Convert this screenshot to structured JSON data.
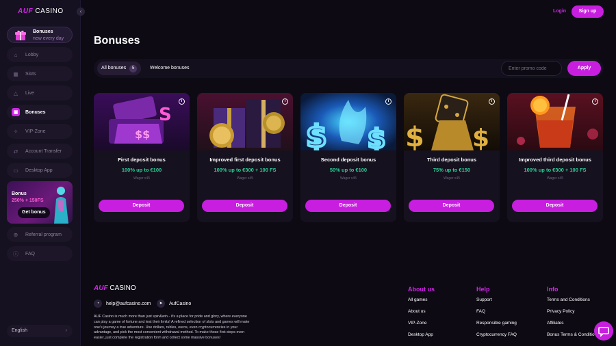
{
  "brand": {
    "auf": "AUF",
    "casino": "CASINO"
  },
  "header": {
    "login": "Login",
    "signup": "Sign up"
  },
  "sidebar": {
    "promo": {
      "title": "Bonuses",
      "subtitle": "new every day"
    },
    "items": [
      {
        "label": "Lobby",
        "icon": "home-icon"
      },
      {
        "label": "Slots",
        "icon": "grid-icon"
      },
      {
        "label": "Live",
        "icon": "live-icon"
      },
      {
        "label": "Bonuses",
        "icon": "gift-icon",
        "active": true
      },
      {
        "label": "VIP-Zone",
        "icon": "vip-icon"
      },
      {
        "label": "Account Transfer",
        "icon": "transfer-icon"
      },
      {
        "label": "Desktop App",
        "icon": "desktop-icon"
      },
      {
        "label": "Referral program",
        "icon": "referral-icon"
      },
      {
        "label": "FAQ",
        "icon": "info-icon"
      }
    ],
    "banner": {
      "title": "Bonus",
      "amount": "250% + 150FS",
      "button": "Get bonus"
    },
    "language": "English"
  },
  "page": {
    "title": "Bonuses"
  },
  "filters": {
    "tabs": [
      {
        "label": "All bonuses",
        "count": "5"
      },
      {
        "label": "Welcome bonuses"
      }
    ],
    "promo_placeholder": "Enter promo code",
    "apply": "Apply"
  },
  "cards": [
    {
      "title": "First deposit bonus",
      "amount": "100% up to €100",
      "wager": "Wager x45",
      "button": "Deposit"
    },
    {
      "title": "Improved first deposit bonus",
      "amount": "100% up to €300 + 100 FS",
      "wager": "Wager x45",
      "button": "Deposit"
    },
    {
      "title": "Second deposit bonus",
      "amount": "50% up to €100",
      "wager": "Wager x45",
      "button": "Deposit"
    },
    {
      "title": "Third deposit bonus",
      "amount": "75% up to €150",
      "wager": "Wager x45",
      "button": "Deposit"
    },
    {
      "title": "Improved third deposit bonus",
      "amount": "100% up to €300 + 100 FS",
      "wager": "Wager x45",
      "button": "Deposit"
    }
  ],
  "footer": {
    "email": "help@aufcasino.com",
    "telegram": "AufCasino",
    "text": "AUF Casino is much more than just spin&win - it's a place for pride and glory, where everyone can play a game of fortune and test their limits! A refined selection of slots and games will make one's journey a true adventure. Use dollars, rubles, euros, even cryptocurrencies in your advantage, and pick the most convenient withdrawal method. To make those first steps even easier, just complete the registration form and collect some massive bonuses!",
    "columns": [
      {
        "title": "About us",
        "links": [
          "All games",
          "About us",
          "VIP-Zone",
          "Desktop App"
        ]
      },
      {
        "title": "Help",
        "links": [
          "Support",
          "FAQ",
          "Responsible gaming",
          "Cryptocurrency FAQ"
        ]
      },
      {
        "title": "Info",
        "links": [
          "Terms and Conditions",
          "Privacy Policy",
          "Affiliates",
          "Bonus Terms & Conditions"
        ]
      }
    ]
  },
  "colors": {
    "accent": "#c81ee0",
    "bonus_green": "#2fd098",
    "background": "#0d0a14"
  }
}
